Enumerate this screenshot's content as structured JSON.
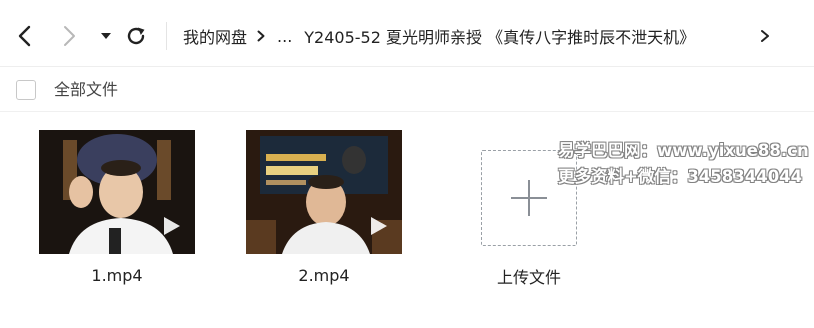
{
  "toolbar": {
    "back_icon": "chevron-left-icon",
    "forward_icon": "chevron-right-icon",
    "dropdown_icon": "caret-down-icon",
    "refresh_icon": "refresh-icon"
  },
  "breadcrumb": {
    "root": "我的网盘",
    "ellipsis": "...",
    "current": "Y2405-52 夏光明师亲授 《真传八字推时辰不泄天机》"
  },
  "select_bar": {
    "label": "全部文件"
  },
  "files": [
    {
      "name": "1.mp4",
      "type": "video"
    },
    {
      "name": "2.mp4",
      "type": "video"
    }
  ],
  "upload": {
    "label": "上传文件",
    "icon": "plus-icon"
  },
  "watermark": {
    "line1": "易学巴巴网：www.yixue88.cn",
    "line2": "更多资料+微信：3458344044"
  },
  "colors": {
    "border": "#eeeeee",
    "text": "#222222",
    "upload_border": "#9aa0a6"
  }
}
